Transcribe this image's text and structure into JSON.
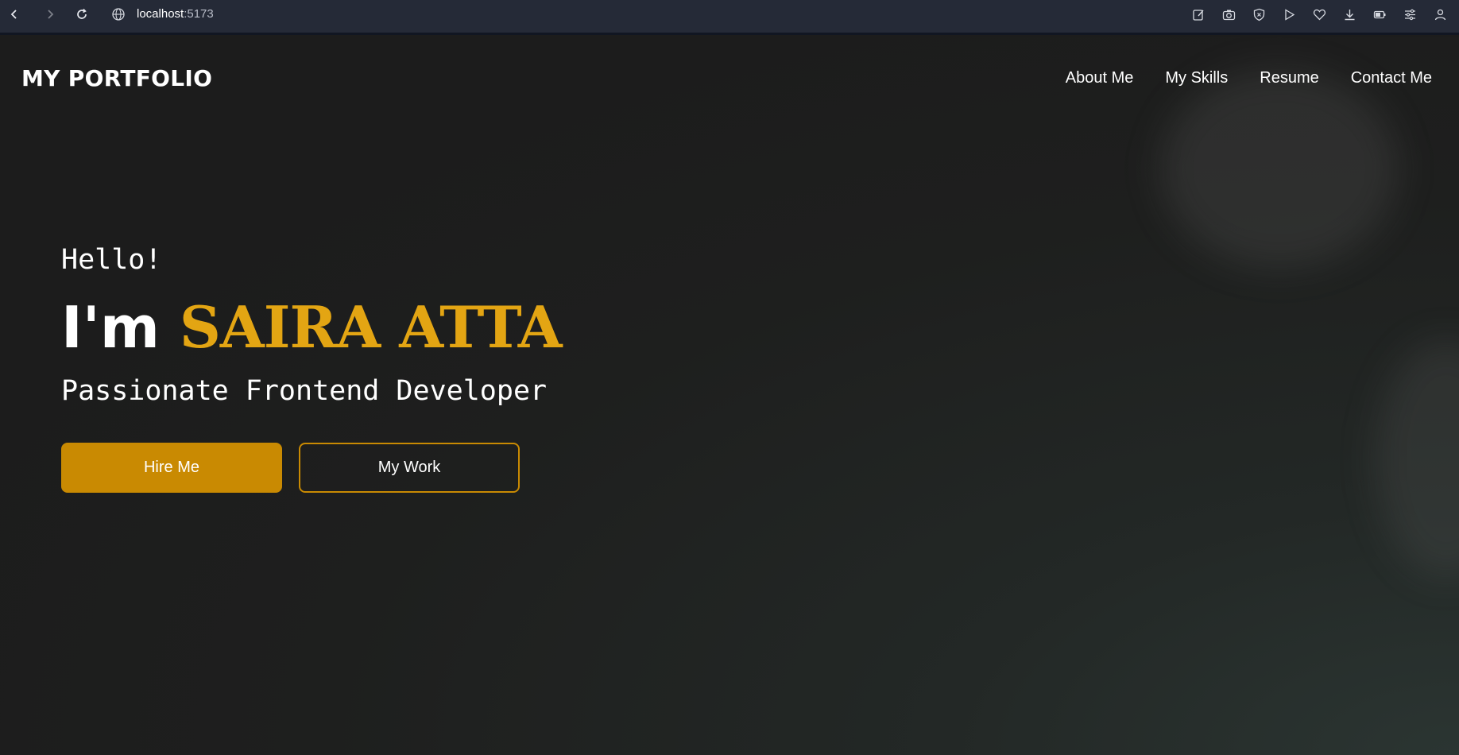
{
  "browser": {
    "url_host": "localhost",
    "url_port": ":5173",
    "icons": [
      "back-icon",
      "forward-icon",
      "reload-icon",
      "globe-icon",
      "edit-icon",
      "camera-icon",
      "shield-icon",
      "play-icon",
      "heart-icon",
      "download-icon",
      "battery-icon",
      "sliders-icon",
      "profile-icon"
    ]
  },
  "navbar": {
    "logo": "MY PORTFOLIO",
    "links": [
      {
        "label": "About Me"
      },
      {
        "label": "My Skills"
      },
      {
        "label": "Resume"
      },
      {
        "label": "Contact Me"
      }
    ]
  },
  "hero": {
    "greeting": "Hello!",
    "im": "I'm ",
    "name": "SAIRA ATTA",
    "role": "Passionate Frontend Developer",
    "primary_button": "Hire Me",
    "secondary_button": "My Work"
  },
  "colors": {
    "accent": "#e3a513",
    "button": "#c98a02",
    "background": "#1c1c1c"
  }
}
